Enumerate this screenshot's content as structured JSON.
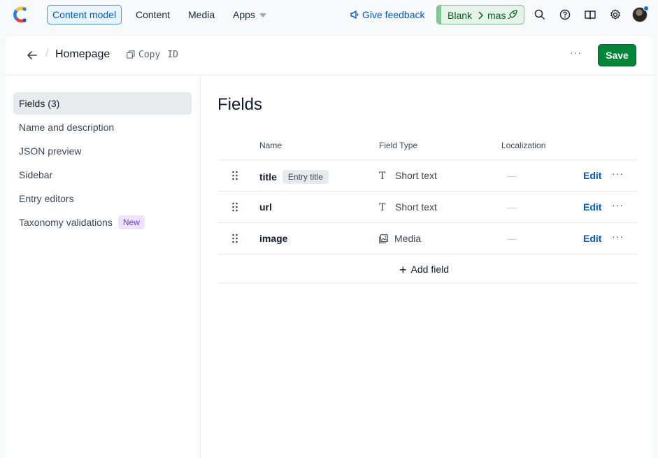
{
  "topnav": {
    "items": [
      {
        "label": "Content model",
        "active": true
      },
      {
        "label": "Content"
      },
      {
        "label": "Media"
      },
      {
        "label": "Apps"
      }
    ],
    "feedback_label": "Give feedback",
    "environment": {
      "space": "Blank",
      "env": "mas"
    },
    "icons": [
      "search-icon",
      "help-icon",
      "book-icon",
      "gear-icon"
    ],
    "accent": "#0059c8"
  },
  "header": {
    "title": "Homepage",
    "copy_label": "Copy",
    "id_label": "ID",
    "more_label": "···",
    "save_label": "Save",
    "save_color": "#008539"
  },
  "sidebar": {
    "items": [
      {
        "label": "Fields (3)",
        "active": true
      },
      {
        "label": "Name and description"
      },
      {
        "label": "JSON preview"
      },
      {
        "label": "Sidebar"
      },
      {
        "label": "Entry editors"
      },
      {
        "label": "Taxonomy validations",
        "badge": "New"
      }
    ]
  },
  "main": {
    "title": "Fields",
    "columns": [
      "Name",
      "Field Type",
      "Localization"
    ],
    "fields": [
      {
        "name": "title",
        "badge": "Entry title",
        "type": "Short text",
        "type_icon": "text-icon",
        "localization": "—",
        "edit": "Edit",
        "more": "···"
      },
      {
        "name": "url",
        "type": "Short text",
        "type_icon": "text-icon",
        "localization": "—",
        "edit": "Edit",
        "more": "···"
      },
      {
        "name": "image",
        "type": "Media",
        "type_icon": "media-icon",
        "localization": "—",
        "edit": "Edit",
        "more": "···"
      }
    ],
    "add_field_label": "Add field"
  }
}
